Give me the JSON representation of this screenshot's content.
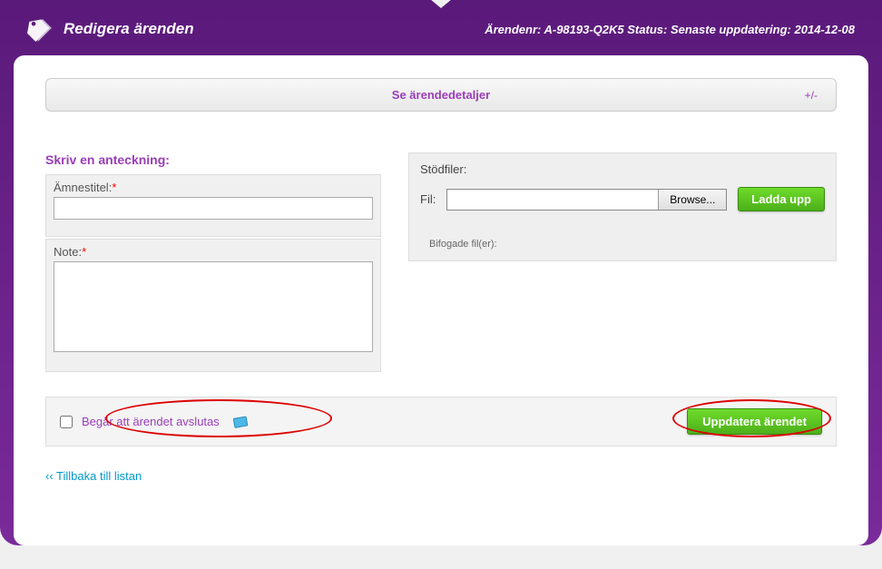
{
  "header": {
    "title": "Redigera ärenden",
    "case_label": "Ärendenr:",
    "case_number": "A-98193-Q2K5",
    "status_label": "Status:",
    "status_value": "",
    "updated_label": "Senaste uppdatering:",
    "updated_value": "2014-12-08"
  },
  "details_banner": {
    "title": "Se ärendedetaljer",
    "toggle": "+/-"
  },
  "note_form": {
    "section_title": "Skriv en anteckning:",
    "subject_label": "Ämnestitel:",
    "note_label": "Note:",
    "subject_value": "",
    "note_value": ""
  },
  "files": {
    "section_title": "Stödfiler:",
    "file_label": "Fil:",
    "browse_label": "Browse...",
    "upload_label": "Ladda upp",
    "attached_label": "Bifogade fil(er):"
  },
  "footer": {
    "close_request_label": "Begär att ärendet avslutas",
    "submit_label": "Uppdatera ärendet"
  },
  "back_link": "‹‹ Tillbaka till listan"
}
